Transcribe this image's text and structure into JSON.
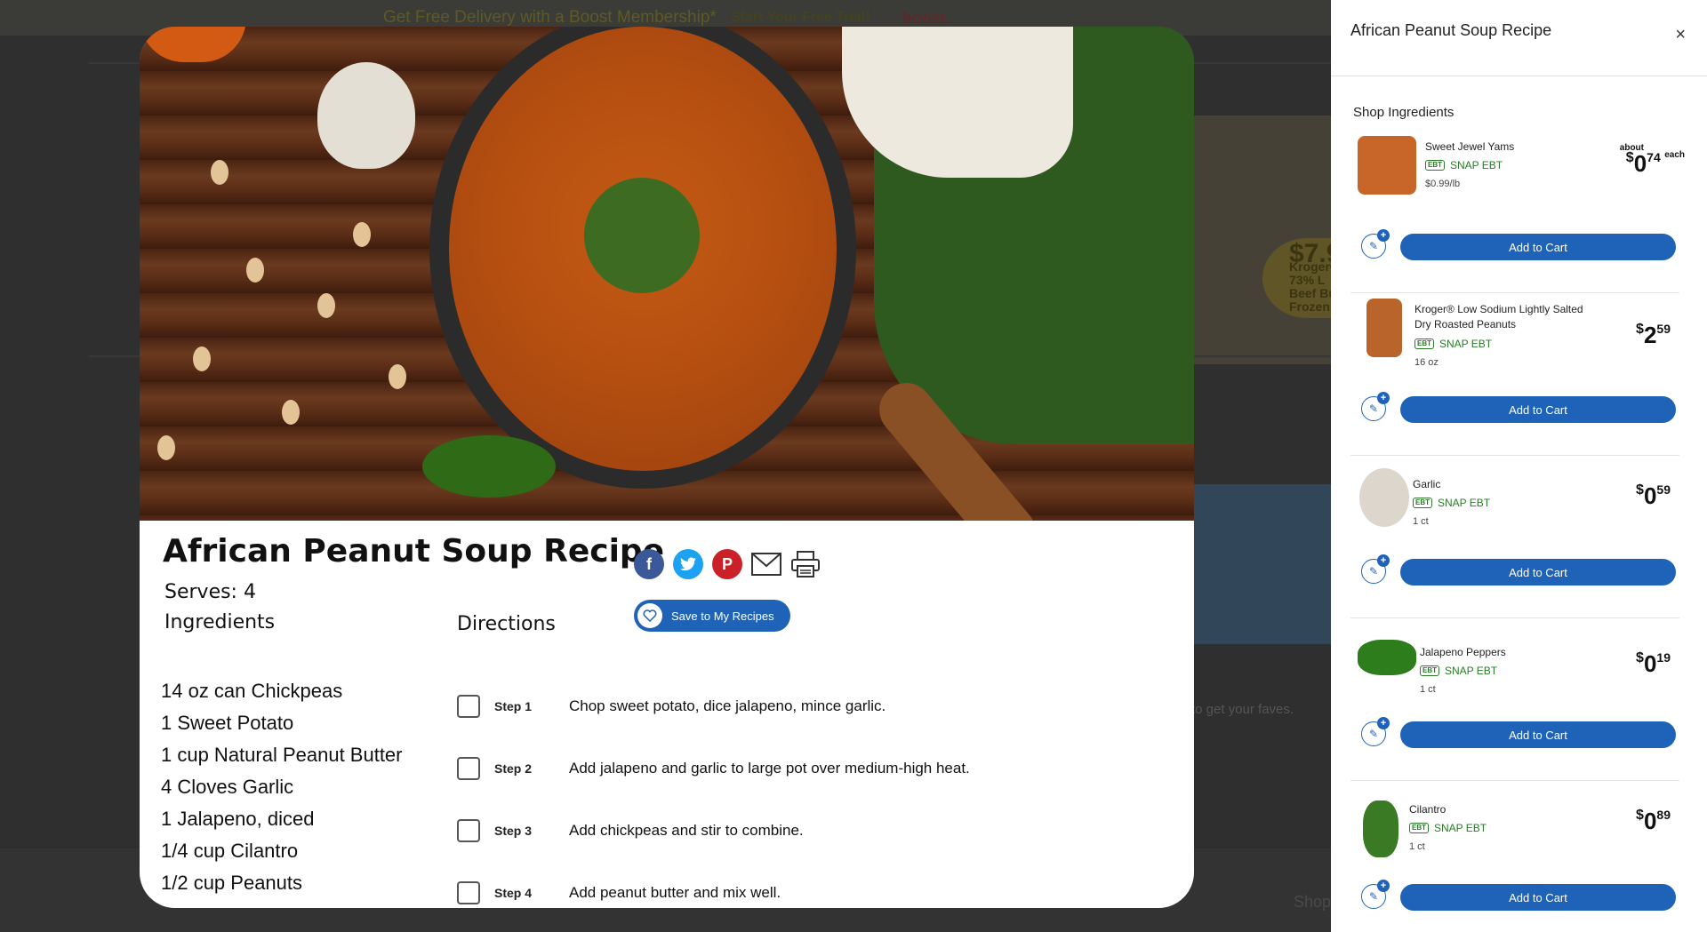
{
  "background": {
    "banner_text": "Get Free Delivery with a Boost Membership*",
    "banner_trial": "Start Your Free Trial! →",
    "banner_brand": "boost.",
    "promo_price": "$7.9",
    "promo_text": "Kroger® 73% L Beef Burg Frozen, 2",
    "faves_text": "to get your faves.",
    "shop_text": "Shop"
  },
  "recipe": {
    "title": "African Peanut Soup Recipe",
    "serves": "Serves: 4",
    "ingredients_heading": "Ingredients",
    "ingredients": [
      "14 oz can Chickpeas",
      "1 Sweet Potato",
      "1 cup Natural Peanut Butter",
      "4 Cloves Garlic",
      "1 Jalapeno, diced",
      "1/4 cup Cilantro",
      "1/2 cup Peanuts"
    ],
    "directions_heading": "Directions",
    "steps": [
      {
        "label": "Step 1",
        "text": "Chop sweet potato, dice jalapeno, mince garlic."
      },
      {
        "label": "Step 2",
        "text": "Add jalapeno and garlic to large pot over medium-high heat."
      },
      {
        "label": "Step 3",
        "text": "Add chickpeas and stir to combine."
      },
      {
        "label": "Step 4",
        "text": "Add peanut butter and mix well."
      }
    ],
    "save_label": "Save to My Recipes",
    "share_icons": [
      "facebook-icon",
      "twitter-icon",
      "pinterest-icon",
      "email-icon",
      "print-icon"
    ]
  },
  "panel": {
    "title": "African Peanut Soup Recipe",
    "close_glyph": "×",
    "shop_heading": "Shop Ingredients",
    "add_label": "Add to Cart",
    "ebt_badge": "EBT",
    "products": [
      {
        "name": "Sweet Jewel Yams",
        "ebt": "SNAP EBT",
        "size": "$0.99/lb",
        "about": "about",
        "dollar": "$",
        "whole": "0",
        "cents": "74",
        "each": "each",
        "color": "#c8662a"
      },
      {
        "name": "Kroger® Low Sodium Lightly Salted Dry Roasted Peanuts",
        "ebt": "SNAP EBT",
        "size": "16 oz",
        "about": "",
        "dollar": "$",
        "whole": "2",
        "cents": "59",
        "each": "",
        "color": "#b8642a"
      },
      {
        "name": "Garlic",
        "ebt": "SNAP EBT",
        "size": "1 ct",
        "about": "",
        "dollar": "$",
        "whole": "0",
        "cents": "59",
        "each": "",
        "color": "#ddd6cc"
      },
      {
        "name": "Jalapeno Peppers",
        "ebt": "SNAP EBT",
        "size": "1 ct",
        "about": "",
        "dollar": "$",
        "whole": "0",
        "cents": "19",
        "each": "",
        "color": "#2e7d1c"
      },
      {
        "name": "Cilantro",
        "ebt": "SNAP EBT",
        "size": "1 ct",
        "about": "",
        "dollar": "$",
        "whole": "0",
        "cents": "89",
        "each": "",
        "color": "#3a7a24"
      }
    ]
  }
}
